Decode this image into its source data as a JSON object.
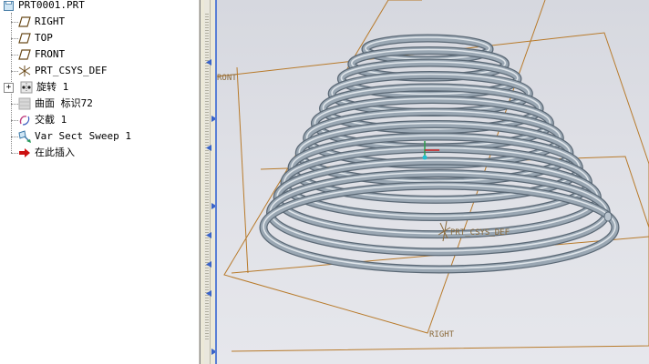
{
  "model_tree": {
    "root": "PRT0001.PRT",
    "items": [
      {
        "label": "RIGHT",
        "icon": "datum-plane-icon"
      },
      {
        "label": "TOP",
        "icon": "datum-plane-icon"
      },
      {
        "label": "FRONT",
        "icon": "datum-plane-icon"
      },
      {
        "label": "PRT_CSYS_DEF",
        "icon": "coordinate-system-icon"
      },
      {
        "label": "旋转 1",
        "icon": "revolve-icon"
      },
      {
        "label": "曲面 标识72",
        "icon": "surface-icon"
      },
      {
        "label": "交截 1",
        "icon": "intersect-icon"
      },
      {
        "label": "Var Sect Sweep 1",
        "icon": "sweep-icon"
      },
      {
        "label": "在此插入",
        "icon": "insert-here-arrow-icon"
      }
    ]
  },
  "viewport": {
    "labels": {
      "front": "RONT",
      "csys": "PRT_CSYS_DEF",
      "right": "RIGHT"
    }
  },
  "colors": {
    "datum": "#b87a2a",
    "spring": "#9aa7b3",
    "insert_arrow": "#cc1111",
    "sash_blue": "#5a7fd6"
  }
}
